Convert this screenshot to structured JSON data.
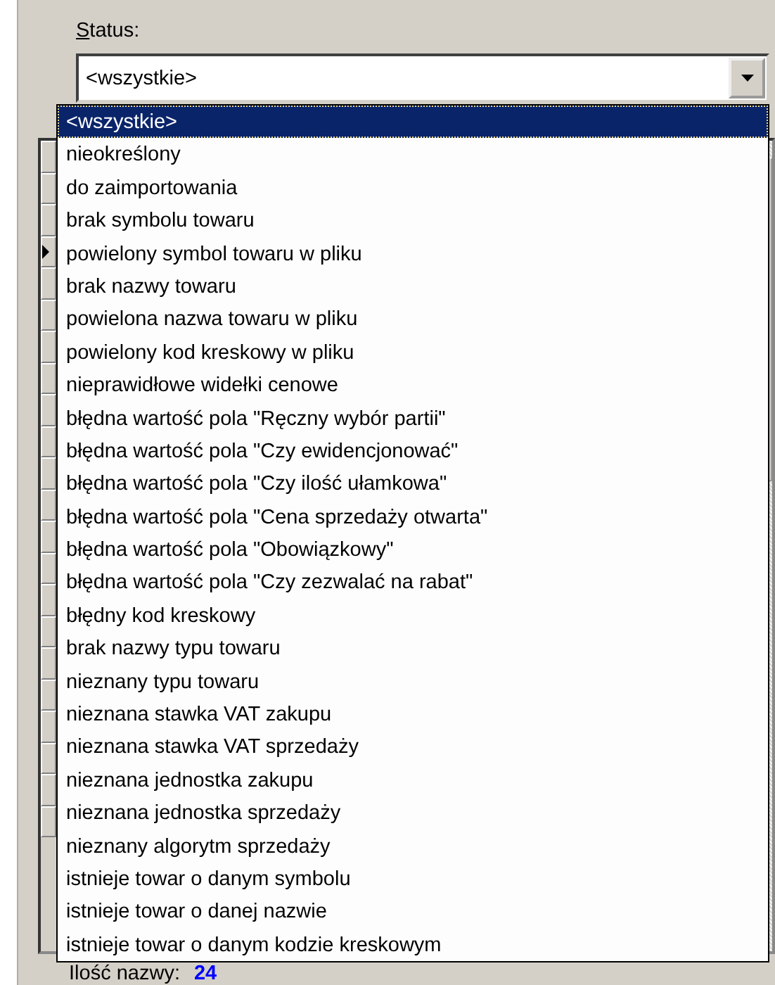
{
  "status_filter": {
    "label": "Status:",
    "value": "<wszystkie>",
    "expanded": true,
    "options": [
      {
        "label": "<wszystkie>",
        "selected": true
      },
      {
        "label": "nieokreślony",
        "selected": false
      },
      {
        "label": "do zaimportowania",
        "selected": false
      },
      {
        "label": "brak symbolu towaru",
        "selected": false
      },
      {
        "label": "powielony symbol towaru w pliku",
        "selected": false
      },
      {
        "label": "brak nazwy towaru",
        "selected": false
      },
      {
        "label": "powielona nazwa towaru w pliku",
        "selected": false
      },
      {
        "label": "powielony kod kreskowy w pliku",
        "selected": false
      },
      {
        "label": "nieprawidłowe widełki cenowe",
        "selected": false
      },
      {
        "label": "błędna wartość pola \"Ręczny wybór partii\"",
        "selected": false
      },
      {
        "label": "błędna wartość pola \"Czy ewidencjonować\"",
        "selected": false
      },
      {
        "label": "błędna wartość pola \"Czy ilość ułamkowa\"",
        "selected": false
      },
      {
        "label": "błędna wartość pola \"Cena sprzedaży otwarta\"",
        "selected": false
      },
      {
        "label": "błędna wartość pola \"Obowiązkowy\"",
        "selected": false
      },
      {
        "label": "błędna wartość pola \"Czy zezwalać na rabat\"",
        "selected": false
      },
      {
        "label": "błędny kod kreskowy",
        "selected": false
      },
      {
        "label": "brak nazwy typu towaru",
        "selected": false
      },
      {
        "label": "nieznany typu towaru",
        "selected": false
      },
      {
        "label": "nieznana stawka VAT zakupu",
        "selected": false
      },
      {
        "label": "nieznana stawka VAT sprzedaży",
        "selected": false
      },
      {
        "label": "nieznana jednostka zakupu",
        "selected": false
      },
      {
        "label": "nieznana jednostka sprzedaży",
        "selected": false
      },
      {
        "label": "nieznany algorytm sprzedaży",
        "selected": false
      },
      {
        "label": "istnieje towar o danym symbolu",
        "selected": false
      },
      {
        "label": "istnieje towar o danej nazwie",
        "selected": false
      },
      {
        "label": "istnieje towar o danym kodzie kreskowym",
        "selected": false
      }
    ]
  },
  "grid": {
    "rows": [
      {
        "current": false
      },
      {
        "current": false
      },
      {
        "current": false
      },
      {
        "current": true
      },
      {
        "current": false
      },
      {
        "current": false
      },
      {
        "current": false
      },
      {
        "current": false
      },
      {
        "current": false
      },
      {
        "current": false
      },
      {
        "current": false
      },
      {
        "current": false
      },
      {
        "current": false
      },
      {
        "current": false
      },
      {
        "current": false
      },
      {
        "current": false
      },
      {
        "current": false
      },
      {
        "current": false
      },
      {
        "current": false
      },
      {
        "current": false
      },
      {
        "current": false
      },
      {
        "current": false
      }
    ]
  },
  "footer": {
    "label": "Ilość nazwy:",
    "value": "24"
  }
}
